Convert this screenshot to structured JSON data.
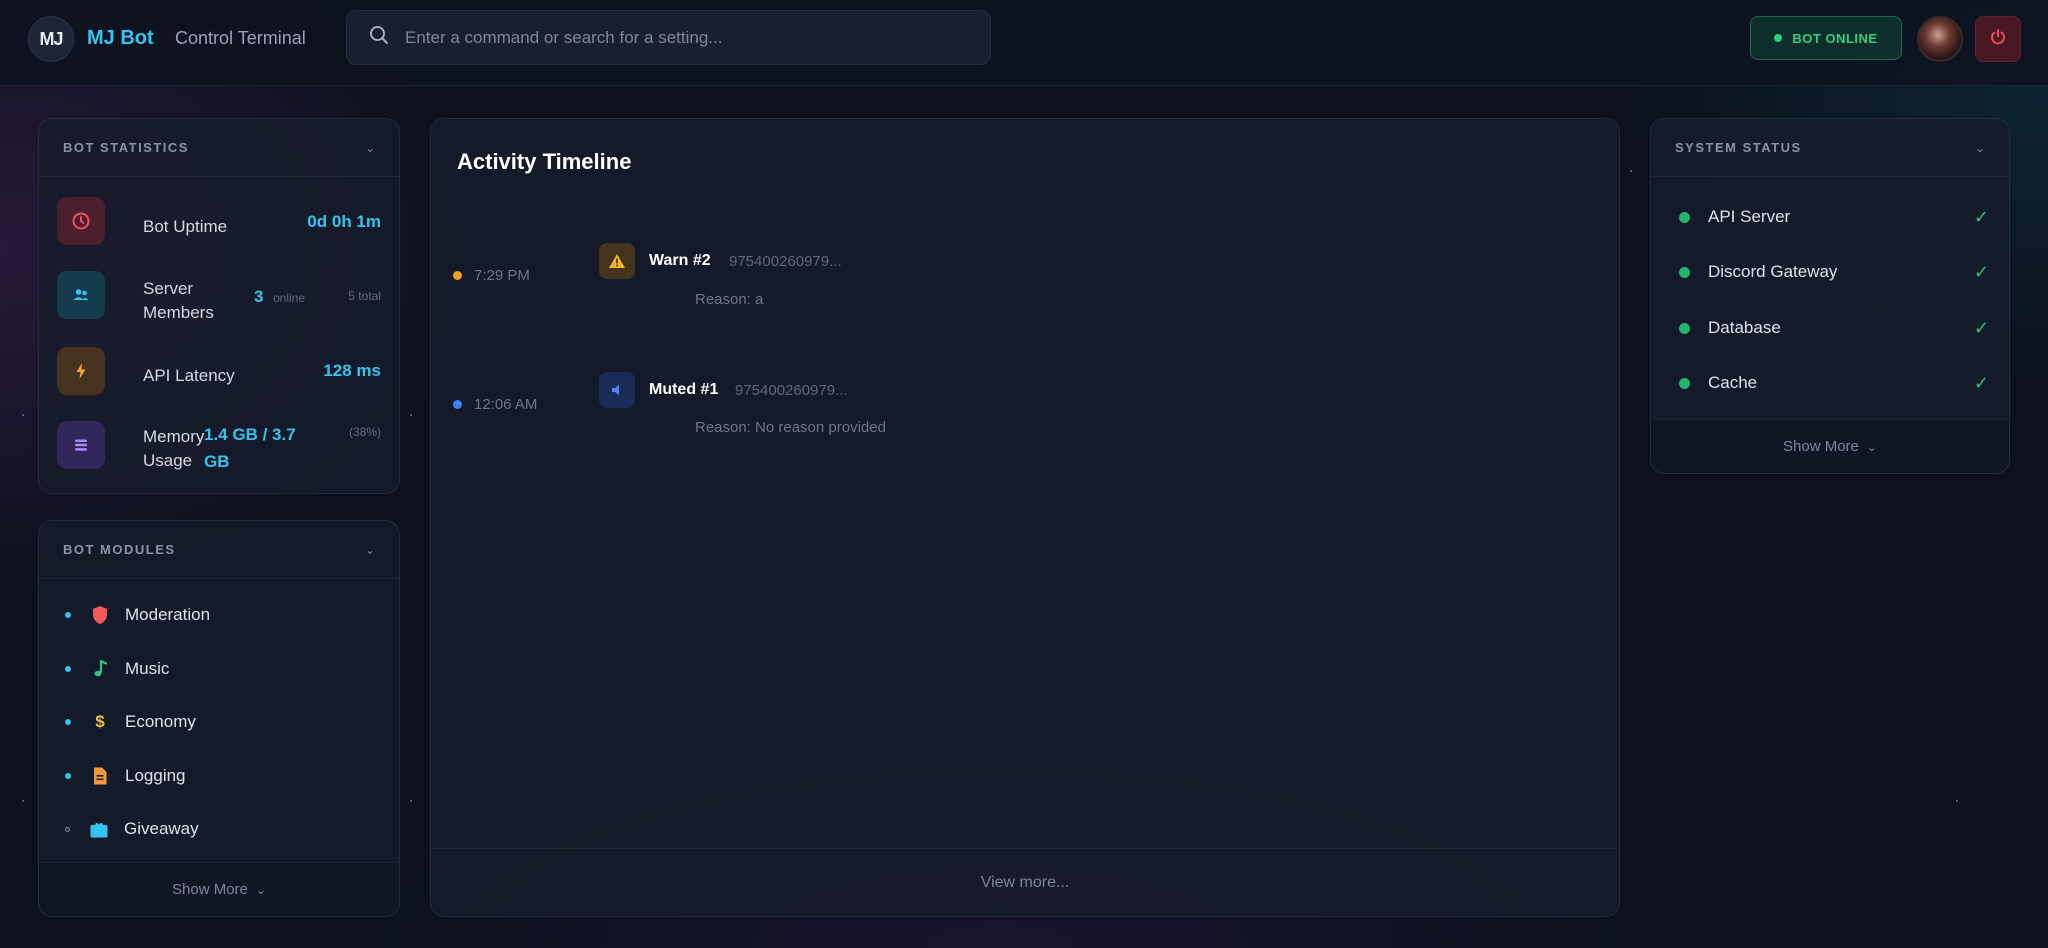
{
  "header": {
    "logo_text": "MJ",
    "brand": "MJ Bot",
    "subtitle": "Control Terminal",
    "search_placeholder": "Enter a command or search for a setting...",
    "status": "BOT ONLINE"
  },
  "bot_statistics": {
    "title": "BOT STATISTICS",
    "uptime_label": "Bot Uptime",
    "uptime_value": "0d 0h 1m",
    "members_label_1": "Server",
    "members_label_2": "Members",
    "members_online": "3",
    "members_online_label": "online",
    "members_total": "5 total",
    "latency_label": "API Latency",
    "latency_value": "128 ms",
    "memory_label_1": "Memory",
    "memory_label_2": "Usage",
    "memory_value_1": "1.4 GB / 3.7",
    "memory_value_2": "GB",
    "memory_percent": "(38%)"
  },
  "bot_modules": {
    "title": "BOT MODULES",
    "items": [
      {
        "label": "Moderation",
        "icon": "shield-icon",
        "color": "#f25a5a"
      },
      {
        "label": "Music",
        "icon": "music-note-icon",
        "color": "#2ec48a"
      },
      {
        "label": "Economy",
        "icon": "dollar-icon",
        "color": "#f2c03a"
      },
      {
        "label": "Logging",
        "icon": "file-icon",
        "color": "#f29a3a"
      },
      {
        "label": "Giveaway",
        "icon": "gift-icon",
        "color": "#33c3ee"
      }
    ],
    "show_more": "Show More"
  },
  "timeline": {
    "title": "Activity Timeline",
    "events": [
      {
        "time": "7:29 PM",
        "action": "Warn #2",
        "user_id": "975400260979...",
        "reason": "Reason: a",
        "dot_color": "#f0a020"
      },
      {
        "time": "12:06 AM",
        "action": "Muted #1",
        "user_id": "975400260979...",
        "reason": "Reason: No reason provided",
        "dot_color": "#3b82f6"
      }
    ],
    "view_more": "View more..."
  },
  "system_status": {
    "title": "SYSTEM STATUS",
    "items": [
      {
        "label": "API Server"
      },
      {
        "label": "Discord Gateway"
      },
      {
        "label": "Database"
      },
      {
        "label": "Cache"
      }
    ],
    "show_more": "Show More"
  }
}
